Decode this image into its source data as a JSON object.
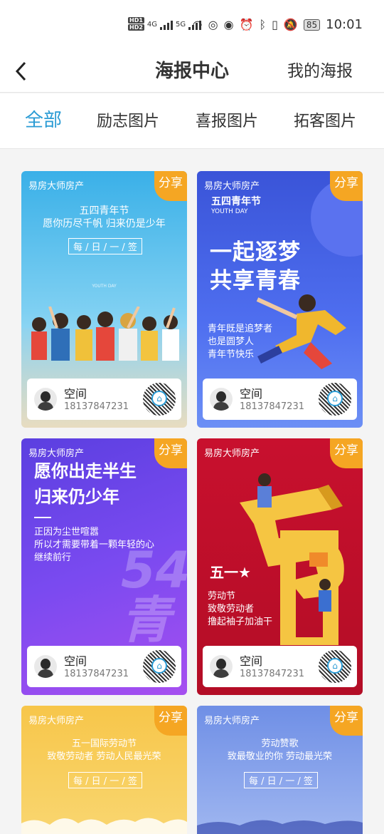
{
  "status_bar": {
    "hd1": "HD1",
    "hd2": "HD2",
    "net1": "4G",
    "net2": "5G",
    "battery": "85",
    "time": "10:01"
  },
  "header": {
    "back_icon": "chevron-left-icon",
    "title": "海报中心",
    "my_posters": "我的海报"
  },
  "tabs": [
    {
      "label": "全部",
      "active": true
    },
    {
      "label": "励志图片",
      "active": false
    },
    {
      "label": "喜报图片",
      "active": false
    },
    {
      "label": "拓客图片",
      "active": false
    }
  ],
  "accent_color": "#2a9bd4",
  "share_color": "#f5a623",
  "cards": [
    {
      "brand": "易房大师房产",
      "share": "分享",
      "line1": "五四青年节",
      "line2": "愿你历尽千帆 归来仍是少年",
      "stamp": "每 / 日 / 一 / 签",
      "tiny": "YOUTH DAY",
      "agent_name": "空间",
      "agent_phone": "18137847231"
    },
    {
      "brand": "易房大师房产",
      "share": "分享",
      "heading": "五四青年节",
      "sub": "YOUTH DAY",
      "big1": "一起逐梦",
      "big2": "共享青春",
      "l1": "青年既是追梦者",
      "l2": "也是圆梦人",
      "l3": "青年节快乐",
      "agent_name": "空间",
      "agent_phone": "18137847231"
    },
    {
      "brand": "易房大师房产",
      "share": "分享",
      "big1": "愿你出走半生",
      "big2": "归来仍少年",
      "l1": "正因为尘世喧嚣",
      "l2": "所以才需要带着一颗年轻的心",
      "l3": "继续前行",
      "deco": "54青",
      "agent_name": "空间",
      "agent_phone": "18137847231"
    },
    {
      "brand": "易房大师房产",
      "share": "分享",
      "big": "五一★",
      "l1": "劳动节",
      "l2": "致敬劳动者",
      "l3": "撸起袖子加油干",
      "agent_name": "空间",
      "agent_phone": "18137847231"
    },
    {
      "brand": "易房大师房产",
      "share": "分享",
      "line1": "五一国际劳动节",
      "line2": "致敬劳动者 劳动人民最光荣",
      "stamp": "每 / 日 / 一 / 签"
    },
    {
      "brand": "易房大师房产",
      "share": "分享",
      "line1": "劳动赞歌",
      "line2": "致最敬业的你 劳动最光荣",
      "stamp": "每 / 日 / 一 / 签"
    }
  ]
}
